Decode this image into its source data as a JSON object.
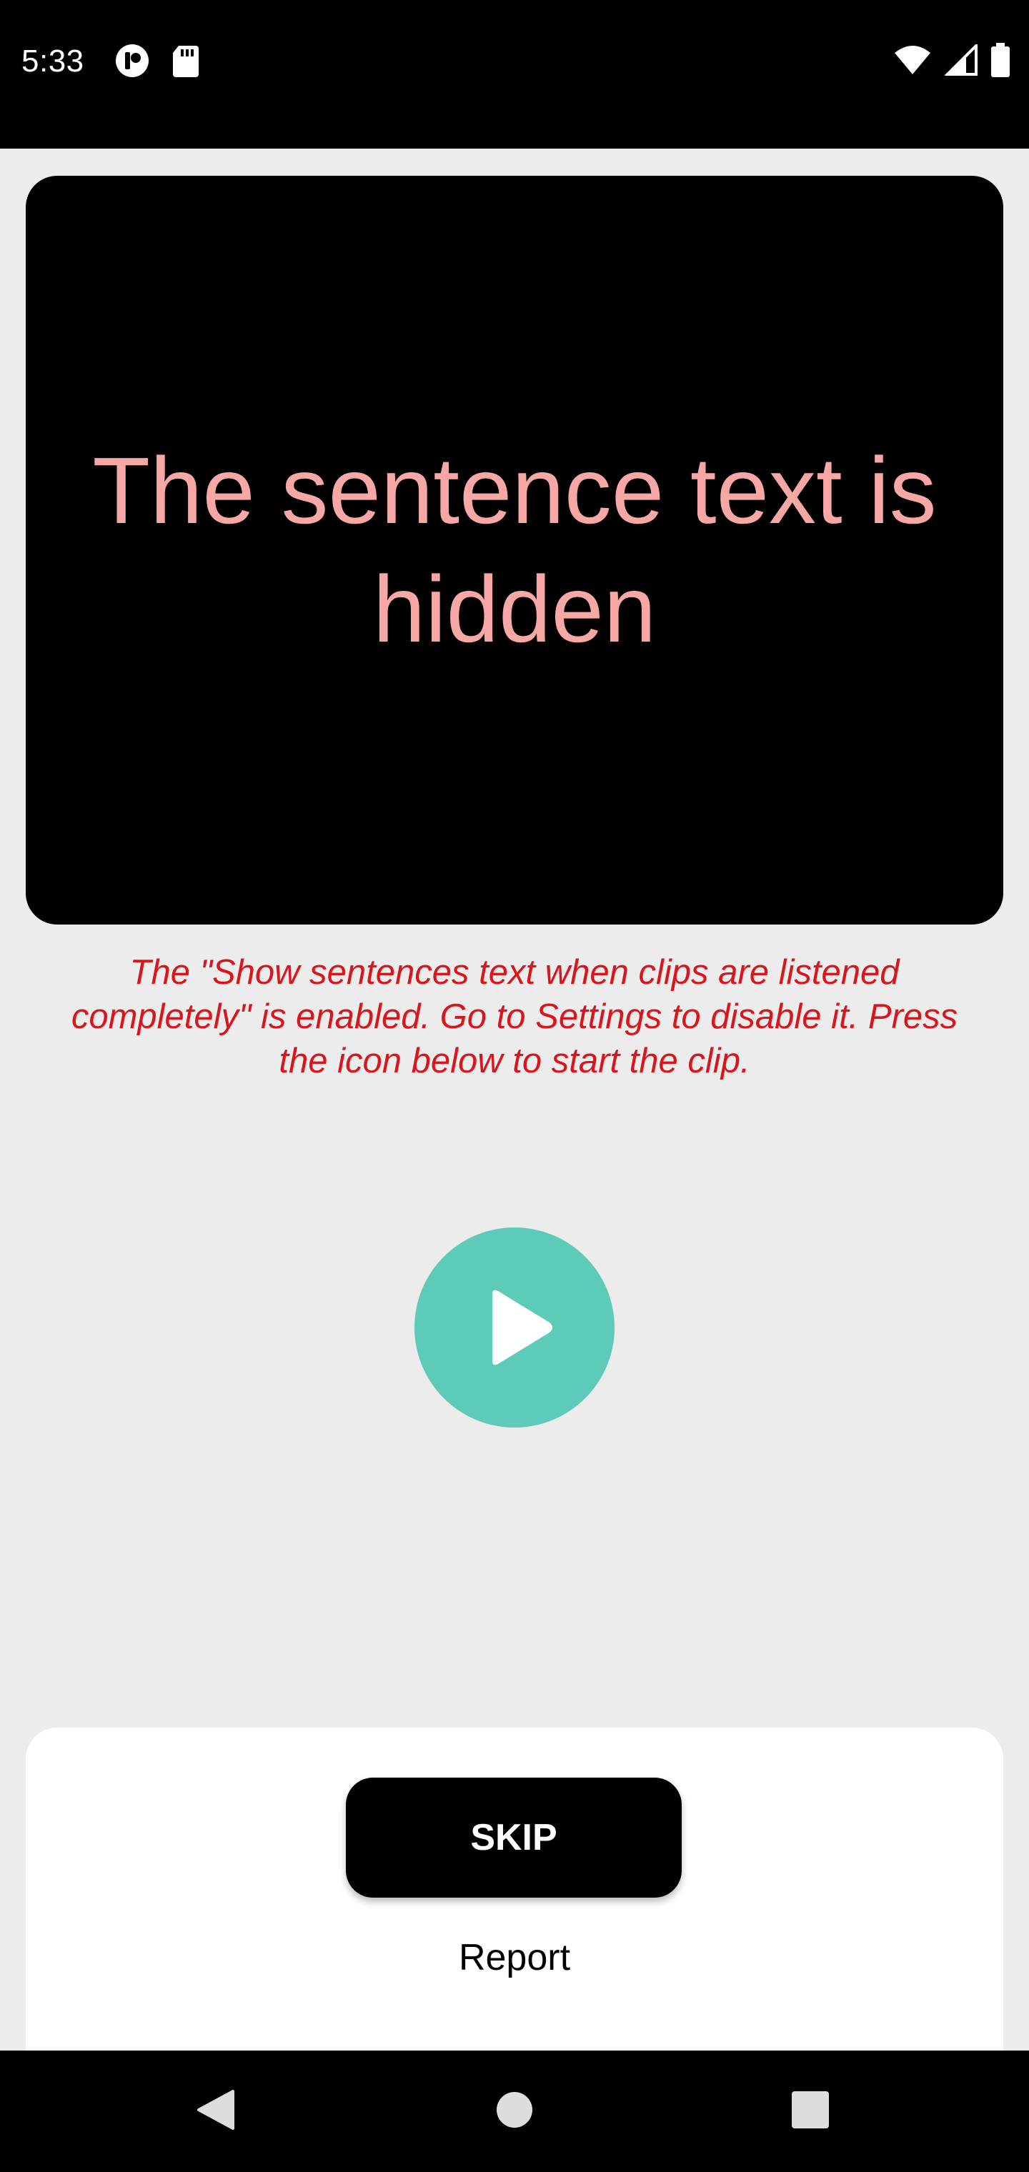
{
  "status_bar": {
    "time": "5:33",
    "icons": [
      "media-app-icon",
      "sd-card-icon",
      "wifi-icon",
      "cell-signal-icon",
      "battery-icon"
    ]
  },
  "sentence_card": {
    "text": "The sentence text is hidden"
  },
  "info_note": {
    "text": "The \"Show sentences text when clips are listened completely\" is enabled. Go to Settings to disable it. Press the icon below to start the clip."
  },
  "play_button": {
    "icon": "play-icon",
    "color": "#5ecbb8"
  },
  "actions": {
    "skip_label": "SKIP",
    "report_label": "Report"
  },
  "nav_bar": {
    "icons": [
      "back-icon",
      "home-icon",
      "recents-icon"
    ]
  },
  "colors": {
    "hidden_text": "#f7a8a4",
    "warning_text": "#d8161b",
    "background": "#ececec"
  }
}
